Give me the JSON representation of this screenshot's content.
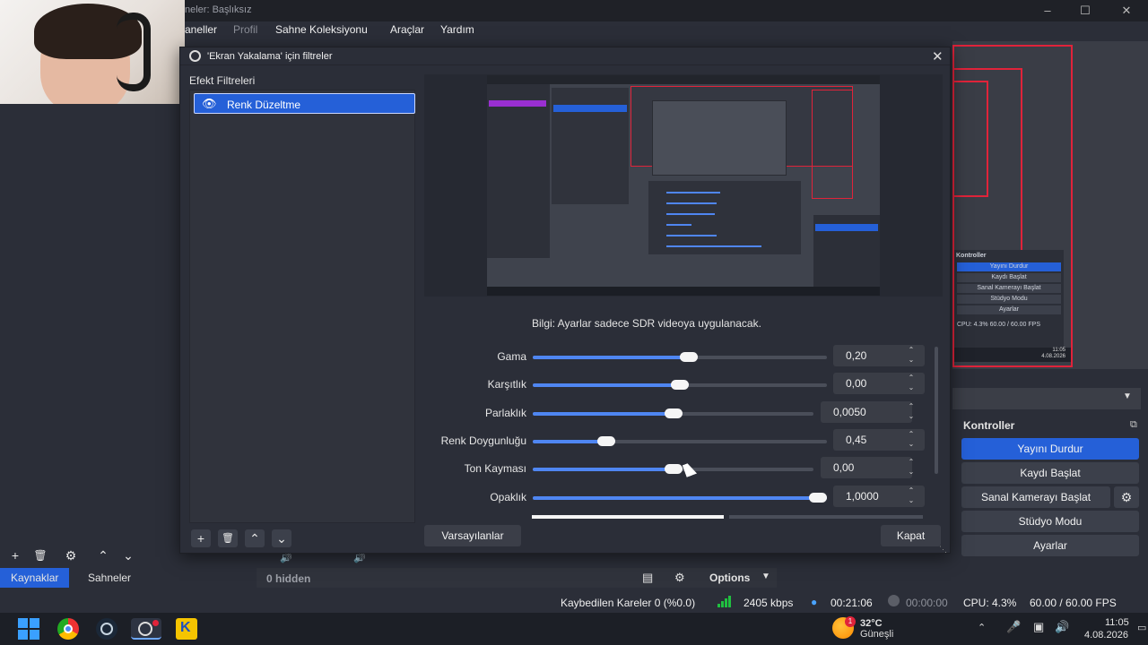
{
  "window": {
    "title_partial": "neler: Başlıksız"
  },
  "menu": [
    "aneller",
    "Profil",
    "Sahne Koleksiyonu",
    "Araçlar",
    "Yardım"
  ],
  "dialog": {
    "title": "'Ekran Yakalama' için filtreler",
    "effect_filters_label": "Efekt Filtreleri",
    "filter_item": "Renk Düzeltme",
    "info": "Bilgi: Ayarlar sadece SDR videoya uygulanacak.",
    "properties": [
      {
        "label": "Gama",
        "value": "0,20",
        "level": 0.53
      },
      {
        "label": "Karşıtlık",
        "value": "0,00",
        "level": 0.5
      },
      {
        "label": "Parlaklık",
        "value": "0,0050",
        "level": 0.5
      },
      {
        "label": "Renk Doygunluğu",
        "value": "0,45",
        "level": 0.25
      },
      {
        "label": "Ton Kayması",
        "value": "0,00",
        "level": 0.5
      },
      {
        "label": "Opaklık",
        "value": "1,0000",
        "level": 1.0
      }
    ],
    "defaults_button": "Varsayılanlar",
    "close_button": "Kapat"
  },
  "controls": {
    "header": "Kontroller",
    "buttons": [
      "Yayını Durdur",
      "Kaydı Başlat",
      "Sanal Kamerayı Başlat",
      "Stüdyo Modu",
      "Ayarlar"
    ]
  },
  "bottom": {
    "tabs": [
      "Kaynaklar",
      "Sahneler"
    ],
    "hidden": "0 hidden",
    "options": "Options"
  },
  "status": {
    "dropped": "Kaybedilen Kareler 0 (%0.0)",
    "bitrate": "2405 kbps",
    "stream_time": "00:21:06",
    "rec_time": "00:00:00",
    "cpu": "CPU: 4.3%",
    "fps": "60.00 / 60.00 FPS"
  },
  "taskbar": {
    "weather_temp": "32°C",
    "weather_desc": "Güneşli",
    "time": "11:05",
    "date": "4.08.2026",
    "badge": "1"
  },
  "preview": {
    "controls_header": "Kontroller",
    "controls_items": [
      "Yayını Durdur",
      "Kaydı Başlat",
      "Sanal Kamerayı Başlat",
      "Stüdyo Modu",
      "Ayarlar"
    ],
    "stats": "CPU: 4.3%   60.00 / 60.00 FPS",
    "time": "11:05",
    "date": "4.08.2026"
  },
  "colors": {
    "accent": "#2560d8",
    "red": "#e0233a",
    "bg": "#2b2e38"
  }
}
